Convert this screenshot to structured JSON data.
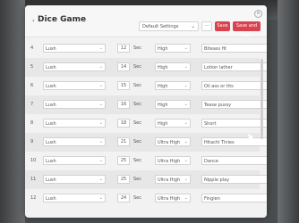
{
  "header": {
    "back": "‹",
    "title": "Dice Game",
    "preset": "Default Settings",
    "more": "···",
    "save": "Save",
    "save_and_start": "Save and Start",
    "close": "×"
  },
  "unit": "Sec",
  "rows": [
    {
      "num": "4",
      "style": "Lush",
      "duration": "12",
      "intensity": "High",
      "action": "Biteass fit"
    },
    {
      "num": "5",
      "style": "Lush",
      "duration": "14",
      "intensity": "High",
      "action": "Lotion lather"
    },
    {
      "num": "6",
      "style": "Lush",
      "duration": "15",
      "intensity": "High",
      "action": "Oil ass or tits"
    },
    {
      "num": "7",
      "style": "Lush",
      "duration": "16",
      "intensity": "High",
      "action": "Tease pussy"
    },
    {
      "num": "8",
      "style": "Lush",
      "duration": "18",
      "intensity": "High",
      "action": "Short"
    },
    {
      "num": "9",
      "style": "Lush",
      "duration": "21",
      "intensity": "Ultra High",
      "action": "Hitachi Tinies"
    },
    {
      "num": "10",
      "style": "Lush",
      "duration": "25",
      "intensity": "Ultra High",
      "action": "Dance"
    },
    {
      "num": "11",
      "style": "Lush",
      "duration": "25",
      "intensity": "Ultra High",
      "action": "Nipple play"
    },
    {
      "num": "12",
      "style": "Lush",
      "duration": "24",
      "intensity": "Ultra High",
      "action": "Fingien"
    }
  ]
}
